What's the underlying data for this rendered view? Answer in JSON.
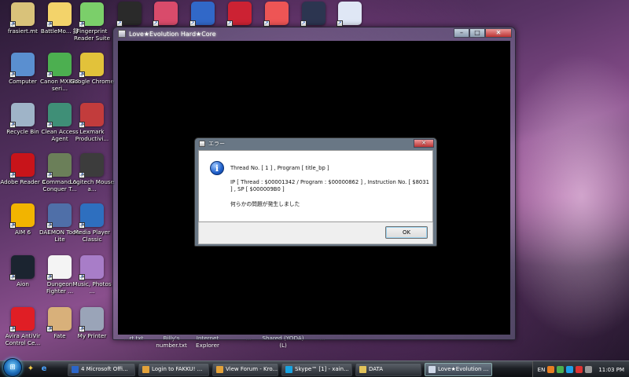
{
  "desktop": {
    "column1": [
      {
        "label": "frasiert.mt",
        "icon": "folder-icon",
        "color": "#d9c27a"
      },
      {
        "label": "Computer",
        "icon": "computer-icon",
        "color": "#5a8fd0"
      },
      {
        "label": "Recycle Bin",
        "icon": "recycle-bin-icon",
        "color": "#9fb4c8"
      },
      {
        "label": "Adobe Reader 8",
        "icon": "adobe-reader-icon",
        "color": "#c8141a"
      },
      {
        "label": "AIM 6",
        "icon": "aim-icon",
        "color": "#f2b400"
      },
      {
        "label": "Aion",
        "icon": "aion-icon",
        "color": "#1b2430"
      },
      {
        "label": "Avira AntiVir Control Ce...",
        "icon": "avira-icon",
        "color": "#e01e25"
      }
    ],
    "column2": [
      {
        "label": "BattleMo... 録",
        "icon": "anime-character-icon",
        "color": "#f3d36a"
      },
      {
        "label": "Canon MX860 seri...",
        "icon": "users-icon",
        "color": "#4caf50"
      },
      {
        "label": "Clean Access Agent",
        "icon": "clean-access-icon",
        "color": "#3f8f77"
      },
      {
        "label": "Command & Conquer T...",
        "icon": "command-conquer-icon",
        "color": "#6b7f59"
      },
      {
        "label": "DAEMON Tools Lite",
        "icon": "daemon-tools-icon",
        "color": "#4f6fa8"
      },
      {
        "label": "Dungeon Fighter ...",
        "icon": "document-icon",
        "color": "#f4f4f4"
      },
      {
        "label": "Fate",
        "icon": "anime-character-icon",
        "color": "#d8b07a"
      }
    ],
    "column3": [
      {
        "label": "Fingerprint Reader Suite",
        "icon": "fingerprint-icon",
        "color": "#7bcf6a"
      },
      {
        "label": "Google Chrome",
        "icon": "chrome-icon",
        "color": "#e2c23a"
      },
      {
        "label": "Lexmark Productivi...",
        "icon": "lexmark-icon",
        "color": "#c23c3c"
      },
      {
        "label": "Logitech Mouse a...",
        "icon": "mouse-icon",
        "color": "#3c3c3c"
      },
      {
        "label": "Media Player Classic",
        "icon": "media-player-icon",
        "color": "#2e6fbf"
      },
      {
        "label": "Music, Photos ...",
        "icon": "music-photos-icon",
        "color": "#a87dc8"
      },
      {
        "label": "My Printer",
        "icon": "anime-character-icon",
        "color": "#9aa4b8"
      }
    ],
    "top_row_icons": [
      {
        "icon": "media-app-icon",
        "color": "#2a2a2a"
      },
      {
        "icon": "anime-girl-icon",
        "color": "#d94b6b"
      },
      {
        "icon": "yamaha-icon",
        "color": "#3168c8"
      },
      {
        "icon": "robot-icon",
        "color": "#c23"
      },
      {
        "icon": "pokeball-icon",
        "color": "#e55"
      },
      {
        "icon": "game-cover-icon",
        "color": "#2c3550"
      },
      {
        "icon": "helmet-icon",
        "color": "#dfe7f5"
      }
    ],
    "obscured_labels": [
      "...rt.txt",
      "Billy's number.txt",
      "Internet Explorer",
      "...",
      "Shared (YODA) (L)",
      "..."
    ]
  },
  "game_window": {
    "title": "Love★Evolution Hard★Core",
    "minimize": "–",
    "maximize": "□",
    "close": "✕"
  },
  "error_dialog": {
    "title": "エラー",
    "close": "✕",
    "line1": "Thread No. [ 1 ] , Program [ title_bp ]",
    "line2": "IP [ Thread : $00001342 / Program : $00000862 ] , Instruction No. [ $8031",
    "line3": "] , SP [ $000009B0 ]",
    "line4": "何らかの問題が発生しました",
    "ok_label": "OK"
  },
  "taskbar": {
    "start": "⊞",
    "tasks": [
      {
        "label": "4 Microsoft Offi...",
        "color": "#2b65c8",
        "active": false
      },
      {
        "label": "Login to FAKKU! ...",
        "color": "#e3a23a",
        "active": false
      },
      {
        "label": "View Forum - Kro...",
        "color": "#e3a23a",
        "active": false
      },
      {
        "label": "Skype™ [1] - xain...",
        "color": "#19a3e0",
        "active": false
      },
      {
        "label": "DATA",
        "color": "#e2c35a",
        "active": false
      },
      {
        "label": "Love★Evolution ...",
        "color": "#cfd8e8",
        "active": true
      }
    ],
    "language": "EN",
    "clock": "11:03 PM"
  }
}
